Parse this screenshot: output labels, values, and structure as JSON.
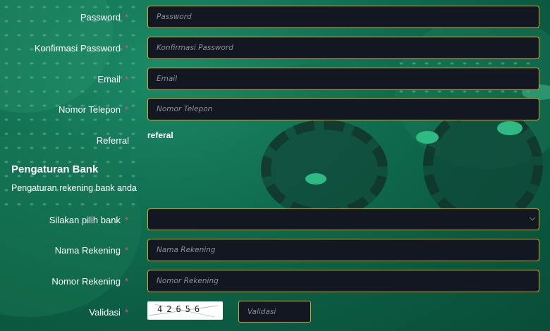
{
  "form": {
    "required_mark": "*",
    "password": {
      "label": "Password",
      "placeholder": "Password"
    },
    "confirm_password": {
      "label": "Konfirmasi Password",
      "placeholder": "Konfirmasi Password"
    },
    "email": {
      "label": "Email",
      "placeholder": "Email"
    },
    "phone": {
      "label": "Nomor Telepon",
      "placeholder": "Nomor Telepon"
    },
    "referral": {
      "label": "Referral",
      "value": "referal"
    }
  },
  "bank": {
    "title": "Pengaturan Bank",
    "subtitle": "Pengaturan rekening bank anda",
    "select_bank": {
      "label": "Silakan pilih bank",
      "value": ""
    },
    "account_name": {
      "label": "Nama Rekening",
      "placeholder": "Nama Rekening"
    },
    "account_number": {
      "label": "Nomor Rekening",
      "placeholder": "Nomor Rekening"
    },
    "validation": {
      "label": "Validasi",
      "captcha_code": "42656",
      "placeholder": "Validasi"
    }
  },
  "colors": {
    "accent_border": "#d4a82a",
    "input_bg": "#131722",
    "required_star": "#e0566a",
    "background": "#0f6a4d"
  }
}
